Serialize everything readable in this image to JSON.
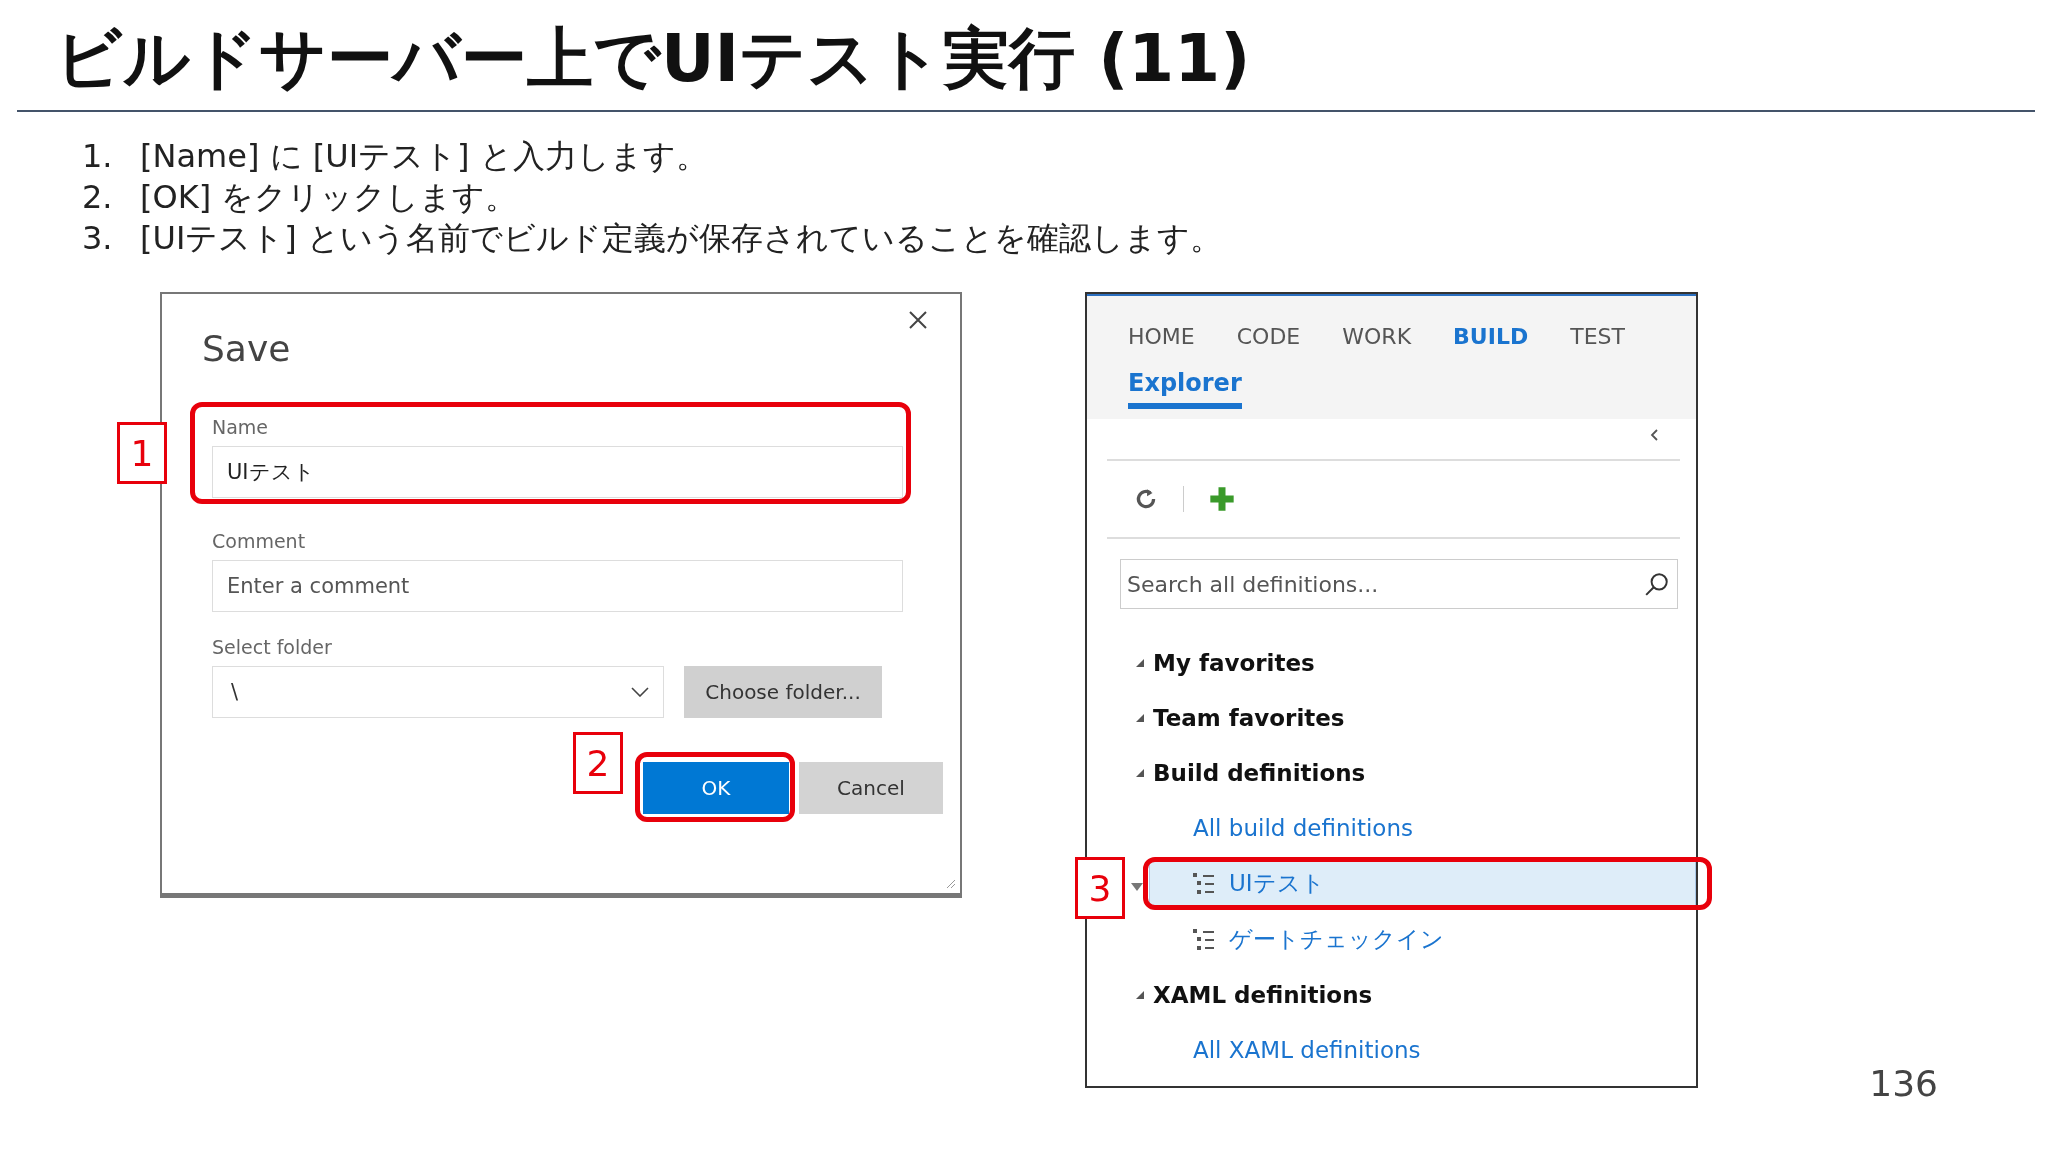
{
  "slide": {
    "title": "ビルドサーバー上でUIテスト実行 (11)",
    "steps": [
      {
        "number": "1.",
        "text": "[Name] に [UIテスト] と入力します。"
      },
      {
        "number": "2.",
        "text": "[OK] をクリックします。"
      },
      {
        "number": "3.",
        "text": "[UIテスト] という名前でビルド定義が保存されていることを確認します。"
      }
    ],
    "page_number": "136"
  },
  "save_dialog": {
    "title": "Save",
    "name": {
      "label": "Name",
      "value": "UIテスト",
      "callout": "1"
    },
    "comment": {
      "label": "Comment",
      "placeholder": "Enter a comment"
    },
    "folder": {
      "label": "Select folder",
      "value": "\\"
    },
    "choose_button": "Choose folder...",
    "buttons": [
      {
        "label": "OK",
        "kind": "primary",
        "callout": "2"
      },
      {
        "label": "Cancel",
        "kind": "secondary"
      }
    ]
  },
  "build_explorer": {
    "tabs": [
      {
        "label": "HOME",
        "selected": false
      },
      {
        "label": "CODE",
        "selected": false
      },
      {
        "label": "WORK",
        "selected": false
      },
      {
        "label": "BUILD",
        "selected": true
      },
      {
        "label": "TEST",
        "selected": false
      }
    ],
    "subtabs": [
      {
        "label": "Explorer",
        "selected": true
      }
    ],
    "search": {
      "placeholder": "Search all definitions..."
    },
    "tree": [
      {
        "label": "My favorites",
        "expanded": true
      },
      {
        "label": "Team favorites",
        "expanded": true
      },
      {
        "label": "Build definitions",
        "expanded": true,
        "children": [
          {
            "label": "All build definitions",
            "kind": "link",
            "selected": false
          },
          {
            "label": "UIテスト",
            "kind": "definition",
            "selected": true,
            "callout": "3"
          },
          {
            "label": "ゲートチェックイン",
            "kind": "definition",
            "selected": false
          }
        ]
      },
      {
        "label": "XAML definitions",
        "expanded": true,
        "children": [
          {
            "label": "All XAML definitions",
            "kind": "link",
            "selected": false
          }
        ]
      }
    ]
  }
}
